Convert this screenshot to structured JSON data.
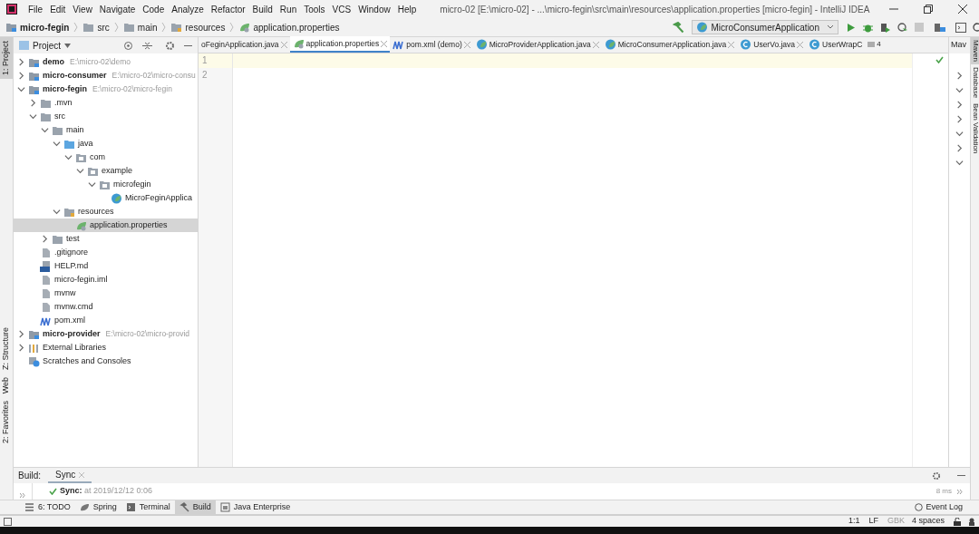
{
  "menu": [
    "File",
    "Edit",
    "View",
    "Navigate",
    "Code",
    "Analyze",
    "Refactor",
    "Build",
    "Run",
    "Tools",
    "VCS",
    "Window",
    "Help"
  ],
  "window": {
    "title": "micro-02 [E:\\micro-02] - ...\\micro-fegin\\src\\main\\resources\\application.properties [micro-fegin] - IntelliJ IDEA"
  },
  "breadcrumbs": [
    {
      "label": "micro-fegin",
      "kind": "module"
    },
    {
      "label": "src",
      "kind": "folder"
    },
    {
      "label": "main",
      "kind": "folder"
    },
    {
      "label": "resources",
      "kind": "resources"
    },
    {
      "label": "application.properties",
      "kind": "properties"
    }
  ],
  "run_config": "MicroConsumerApplication",
  "left_stripe": [
    {
      "label": "1: Project",
      "selected": true
    },
    {
      "label": "Z: Structure",
      "selected": false
    },
    {
      "label": "Web",
      "selected": false
    },
    {
      "label": "2: Favorites",
      "selected": false
    }
  ],
  "project_panel": {
    "title": "Project",
    "tree": [
      {
        "label": "demo",
        "path": "E:\\micro-02\\demo",
        "kind": "module",
        "expanded": false,
        "selected": false
      },
      {
        "label": "micro-consumer",
        "path": "E:\\micro-02\\micro-consu",
        "kind": "module",
        "expanded": false,
        "selected": false
      },
      {
        "label": "micro-fegin",
        "path": "E:\\micro-02\\micro-fegin",
        "kind": "module",
        "expanded": true,
        "selected": false,
        "children": [
          {
            "label": ".mvn",
            "kind": "folder",
            "expanded": false,
            "selected": false
          },
          {
            "label": "src",
            "kind": "folder",
            "expanded": true,
            "selected": false,
            "children": [
              {
                "label": "main",
                "kind": "folder",
                "expanded": true,
                "selected": false,
                "children": [
                  {
                    "label": "java",
                    "kind": "source",
                    "expanded": true,
                    "selected": false,
                    "children": [
                      {
                        "label": "com",
                        "kind": "package",
                        "expanded": true,
                        "selected": false,
                        "children": [
                          {
                            "label": "example",
                            "kind": "package",
                            "expanded": true,
                            "selected": false,
                            "children": [
                              {
                                "label": "microfegin",
                                "kind": "package",
                                "expanded": true,
                                "selected": false,
                                "children": [
                                  {
                                    "label": "MicroFeginApplica",
                                    "kind": "spring-class",
                                    "selected": false
                                  }
                                ]
                              }
                            ]
                          }
                        ]
                      }
                    ]
                  },
                  {
                    "label": "resources",
                    "kind": "resources",
                    "expanded": true,
                    "selected": false,
                    "children": [
                      {
                        "label": "application.properties",
                        "kind": "properties",
                        "selected": true
                      }
                    ]
                  }
                ]
              },
              {
                "label": "test",
                "kind": "folder",
                "expanded": false,
                "selected": false
              }
            ]
          },
          {
            "label": ".gitignore",
            "kind": "file",
            "selected": false
          },
          {
            "label": "HELP.md",
            "kind": "md",
            "selected": false
          },
          {
            "label": "micro-fegin.iml",
            "kind": "file",
            "selected": false
          },
          {
            "label": "mvnw",
            "kind": "file",
            "selected": false
          },
          {
            "label": "mvnw.cmd",
            "kind": "file",
            "selected": false
          },
          {
            "label": "pom.xml",
            "kind": "maven",
            "selected": false
          }
        ]
      },
      {
        "label": "micro-provider",
        "path": "E:\\micro-02\\micro-provid",
        "kind": "module",
        "expanded": false,
        "selected": false
      },
      {
        "label": "External Libraries",
        "kind": "libraries",
        "expanded": false,
        "selected": false
      },
      {
        "label": "Scratches and Consoles",
        "kind": "scratches",
        "selected": false
      }
    ]
  },
  "editor_tabs": [
    {
      "label": "oFeginApplication.java",
      "selected": false
    },
    {
      "label": "application.properties",
      "kind": "properties",
      "selected": true
    },
    {
      "label": "pom.xml (demo)",
      "kind": "maven",
      "selected": false
    },
    {
      "label": "MicroProviderApplication.java",
      "kind": "spring-class",
      "selected": false
    },
    {
      "label": "MicroConsumerApplication.java",
      "kind": "spring-class",
      "selected": false
    },
    {
      "label": "UserVo.java",
      "kind": "class",
      "selected": false
    },
    {
      "label": "UserWrapC",
      "kind": "class",
      "selected": false
    }
  ],
  "hidden_tabs_count": "4",
  "editor": {
    "line_numbers": [
      "1",
      "2"
    ]
  },
  "right_panel": {
    "title": "Mav"
  },
  "right_stripe": [
    {
      "label": "Maven",
      "selected": true
    },
    {
      "label": "Database",
      "selected": false
    },
    {
      "label": "Bean Validation",
      "selected": false
    }
  ],
  "build_panel": {
    "label": "Build:",
    "tabs": [
      {
        "label": "Sync",
        "selected": true
      }
    ],
    "status_label": "Sync:",
    "status_text": "at 2019/12/12 0:06",
    "duration": "8 ms"
  },
  "tool_windows": [
    {
      "label": "6: TODO",
      "kind": "todo",
      "selected": false
    },
    {
      "label": "Spring",
      "kind": "spring",
      "selected": false
    },
    {
      "label": "Terminal",
      "kind": "terminal",
      "selected": false
    },
    {
      "label": "Build",
      "kind": "build",
      "selected": true
    },
    {
      "label": "Java Enterprise",
      "kind": "javaee",
      "selected": false
    }
  ],
  "event_log": "Event Log",
  "status_bar": {
    "position": "1:1",
    "line_separator": "LF",
    "encoding": "GBK",
    "indent": "4 spaces"
  }
}
